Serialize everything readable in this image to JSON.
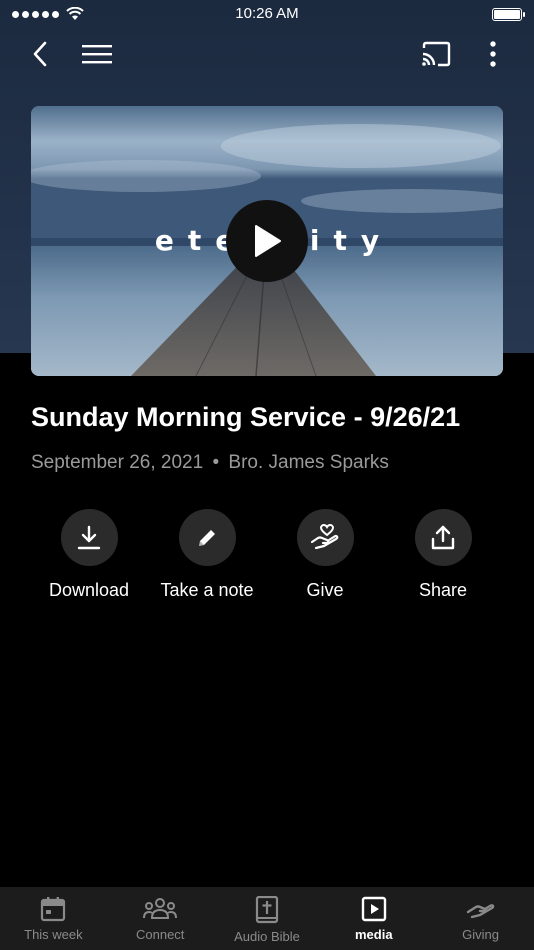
{
  "status_bar": {
    "time": "10:26 AM"
  },
  "media": {
    "artwork_text": "eternity",
    "title": "Sunday Morning Service - 9/26/21",
    "date": "September 26, 2021",
    "separator": "•",
    "speaker": "Bro. James Sparks"
  },
  "actions": [
    {
      "label": "Download",
      "icon": "download-icon"
    },
    {
      "label": "Take a note",
      "icon": "pencil-icon"
    },
    {
      "label": "Give",
      "icon": "give-heart-hand-icon"
    },
    {
      "label": "Share",
      "icon": "share-icon"
    }
  ],
  "tabs": [
    {
      "label": "This week",
      "icon": "calendar-icon",
      "active": false
    },
    {
      "label": "Connect",
      "icon": "people-icon",
      "active": false
    },
    {
      "label": "Audio Bible",
      "icon": "bible-icon",
      "active": false
    },
    {
      "label": "media",
      "icon": "play-square-icon",
      "active": true
    },
    {
      "label": "Giving",
      "icon": "giving-hand-icon",
      "active": false
    }
  ],
  "colors": {
    "background": "#000000",
    "header_band": "#22324a",
    "action_circle": "#2b2b2b",
    "tab_bar": "#1c1c1c",
    "inactive_text": "#8a8a8a",
    "meta_text": "#9a9a9a"
  }
}
